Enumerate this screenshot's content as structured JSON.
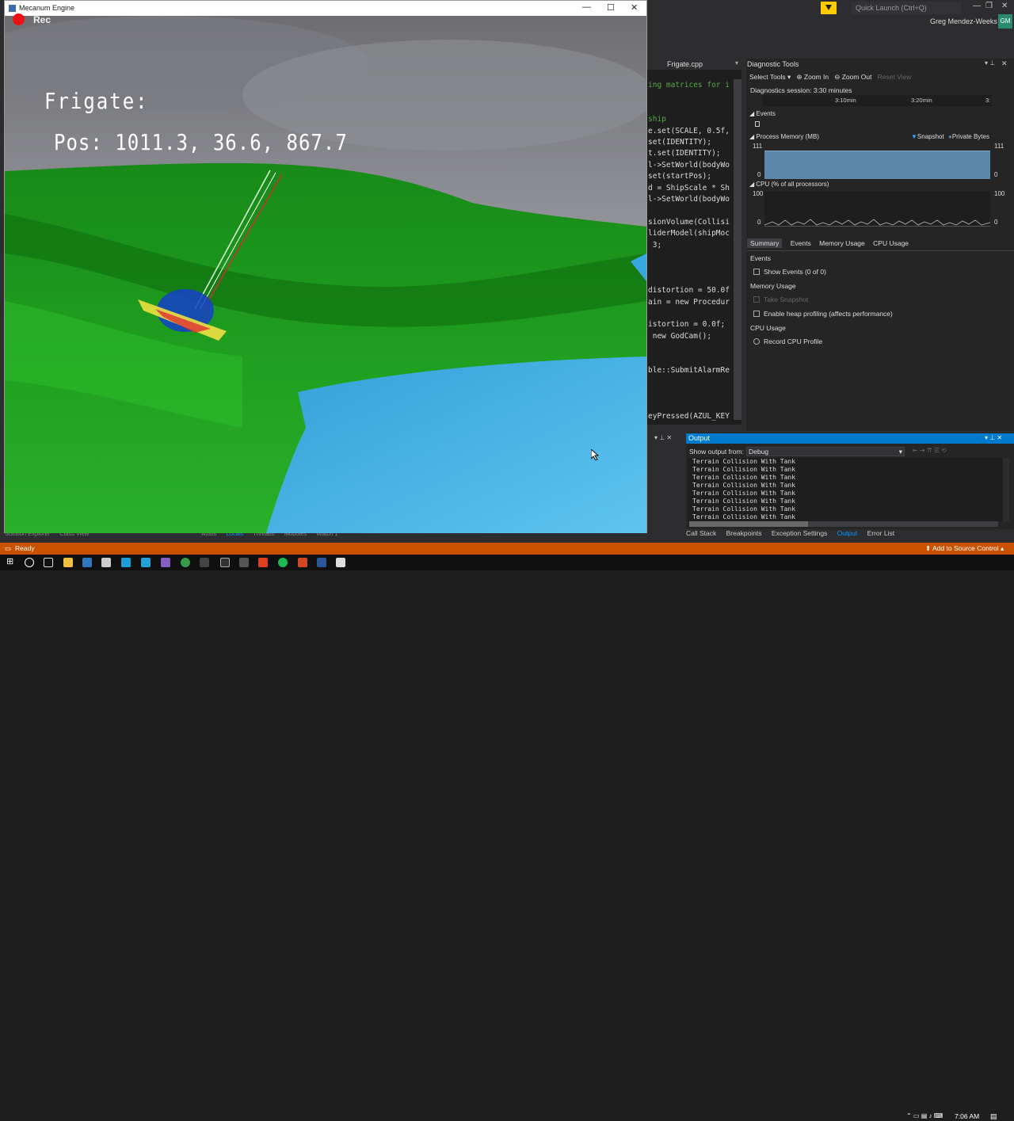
{
  "game": {
    "window_title": "Mecanum Engine",
    "rec_label": "Rec",
    "hud_title": "Frigate:",
    "hud_pos": "Pos: 1011.3, 36.6, 867.7",
    "win_controls": [
      "—",
      "☐",
      "✕"
    ]
  },
  "vs": {
    "quick_launch": "Quick Launch (Ctrl+Q)",
    "user_name": "Greg Mendez-Weeks",
    "user_initials": "GM",
    "editor_tab": "Frigate.cpp",
    "code_lines": [
      "ing matrices for i",
      "",
      "",
      "ship",
      "e.set(SCALE, 0.5f,",
      "set(IDENTITY);",
      "t.set(IDENTITY);",
      "l->SetWorld(bodyWo",
      "set(startPos);",
      "d = ShipScale * Sh",
      "l->SetWorld(bodyWo",
      "",
      "sionVolume(Collisi",
      "liderModel(shipMoc",
      " 3;",
      "",
      "",
      "",
      "distortion = 50.0f",
      "ain = new Procedur",
      "",
      "istortion = 0.0f;",
      " new GodCam();",
      "",
      "",
      "ble::SubmitAlarmRe",
      "",
      "",
      "",
      "eyPressed(AZUL_KEY"
    ]
  },
  "diagnostics": {
    "title": "Diagnostic Tools",
    "select_tools": "Select Tools ▾",
    "zoom_in": "Zoom In",
    "zoom_out": "Zoom Out",
    "reset_view": "Reset View",
    "session": "Diagnostics session: 3:30 minutes",
    "ruler_ticks": [
      "3:10min",
      "3:20min",
      "3:"
    ],
    "events_label": "Events",
    "process_memory_label": "Process Memory (MB)",
    "snapshot_legend": "Snapshot",
    "private_bytes_legend": "Private Bytes",
    "mem_max": "111",
    "mem_min": "0",
    "cpu_label": "CPU (% of all processors)",
    "cpu_max": "100",
    "cpu_min": "0",
    "tabs": [
      "Summary",
      "Events",
      "Memory Usage",
      "CPU Usage"
    ],
    "summary": {
      "events_h": "Events",
      "show_events": "Show Events (0 of 0)",
      "memory_h": "Memory Usage",
      "take_snapshot": "Take Snapshot",
      "enable_heap": "Enable heap profiling (affects performance)",
      "cpu_h": "CPU Usage",
      "record_cpu": "Record CPU Profile"
    }
  },
  "output": {
    "title": "Output",
    "show_from_label": "Show output from:",
    "show_from_value": "Debug",
    "lines": [
      "Terrain Collision With Tank",
      "Terrain Collision With Tank",
      "Terrain Collision With Tank",
      "Terrain Collision With Tank",
      "Terrain Collision With Tank",
      "Terrain Collision With Tank",
      "Terrain Collision With Tank",
      "Terrain Collision With Tank"
    ],
    "bottom_tabs": [
      "Call Stack",
      "Breakpoints",
      "Exception Settings",
      "Output",
      "Error List"
    ],
    "left_tabs": [
      "Solution Explorer",
      "Class View",
      "Autos",
      "Locals",
      "Threads",
      "Modules",
      "Watch 1"
    ]
  },
  "status": {
    "ready": "Ready",
    "source_control": "Add to Source Control ▴"
  },
  "taskbar": {
    "time": "7:06 AM"
  }
}
